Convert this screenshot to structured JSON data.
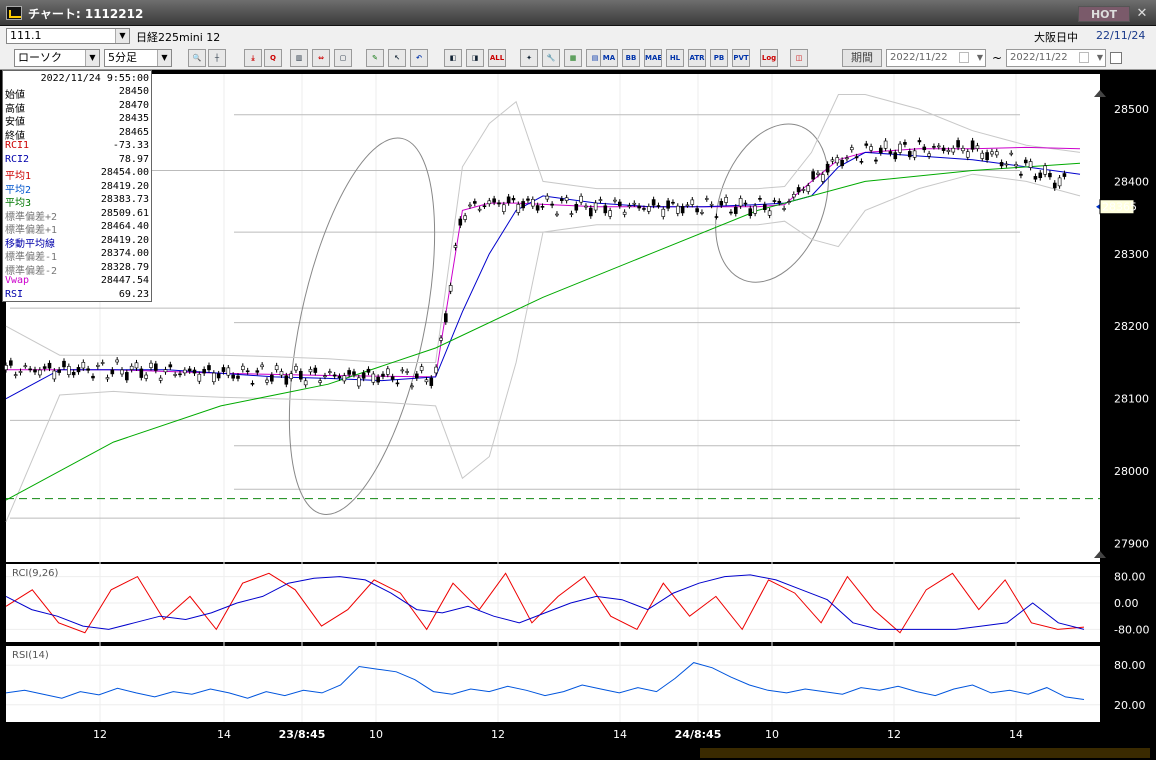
{
  "window": {
    "title": "チャート: 1112212",
    "hot_label": "HOT",
    "close_glyph": "✕"
  },
  "row1": {
    "code": "111.1",
    "instrument": "日経225mini 12",
    "market": "大阪日中",
    "date": "22/11/24"
  },
  "toolbar": {
    "chart_type": "ローソク",
    "interval": "5分足",
    "period_label": "期間",
    "date_from": "2022/11/22",
    "date_to": "2022/11/22",
    "tilde": "~",
    "buttons": [
      {
        "name": "zoom-icon",
        "glyph": "🔍",
        "cls": "ic-blue"
      },
      {
        "name": "crosshair-icon",
        "glyph": "┼",
        "cls": ""
      },
      {
        "name": "cursor-icon",
        "glyph": "⤓",
        "cls": "ic-red"
      },
      {
        "name": "magnifier-icon",
        "glyph": "Q",
        "cls": "ic-red"
      },
      {
        "name": "bar-chart-icon",
        "glyph": "▥",
        "cls": ""
      },
      {
        "name": "order-icon",
        "glyph": "⇔",
        "cls": "ic-red"
      },
      {
        "name": "disabled-icon",
        "glyph": "▢",
        "cls": ""
      },
      {
        "name": "pencil-icon",
        "glyph": "✎",
        "cls": "ic-green"
      },
      {
        "name": "select-arrow-icon",
        "glyph": "↖",
        "cls": ""
      },
      {
        "name": "undo-icon",
        "glyph": "↶",
        "cls": "ic-blue"
      },
      {
        "name": "candle-left-icon",
        "glyph": "◧",
        "cls": ""
      },
      {
        "name": "candle-right-icon",
        "glyph": "◨",
        "cls": ""
      },
      {
        "name": "all-icon",
        "glyph": "ALL",
        "cls": "ic-red"
      },
      {
        "name": "tools-icon",
        "glyph": "✦",
        "cls": ""
      },
      {
        "name": "wrench-icon",
        "glyph": "🔧",
        "cls": "ic-red"
      },
      {
        "name": "palette-icon",
        "glyph": "▦",
        "cls": "ic-green"
      },
      {
        "name": "grid-icon",
        "glyph": "▤",
        "cls": "ic-blue"
      },
      {
        "name": "ma-icon",
        "glyph": "MA",
        "cls": "ic-blue"
      },
      {
        "name": "bb-icon",
        "glyph": "BB",
        "cls": "ic-blue"
      },
      {
        "name": "mae-icon",
        "glyph": "MAE",
        "cls": "ic-blue"
      },
      {
        "name": "hl-icon",
        "glyph": "HL",
        "cls": "ic-blue"
      },
      {
        "name": "atr-icon",
        "glyph": "ATR",
        "cls": "ic-blue"
      },
      {
        "name": "pb-icon",
        "glyph": "PB",
        "cls": "ic-blue"
      },
      {
        "name": "pvt-icon",
        "glyph": "PVT",
        "cls": "ic-blue"
      },
      {
        "name": "log-icon",
        "glyph": "Log",
        "cls": "ic-red"
      },
      {
        "name": "split-icon",
        "glyph": "◫",
        "cls": "ic-red"
      }
    ]
  },
  "info": {
    "timestamp": "2022/11/24 9:55:00",
    "rows": [
      {
        "k": "始値",
        "v": "28450",
        "color": "#000000"
      },
      {
        "k": "高値",
        "v": "28470",
        "color": "#000000"
      },
      {
        "k": "安値",
        "v": "28435",
        "color": "#000000"
      },
      {
        "k": "終値",
        "v": "28465",
        "color": "#000000"
      },
      {
        "k": "RCI1",
        "v": "-73.33",
        "color": "#cc0000"
      },
      {
        "k": "RCI2",
        "v": "78.97",
        "color": "#0000aa"
      },
      {
        "k": "平均1",
        "v": "28454.00",
        "color": "#cc0000"
      },
      {
        "k": "平均2",
        "v": "28419.20",
        "color": "#0055cc"
      },
      {
        "k": "平均3",
        "v": "28383.73",
        "color": "#007700"
      },
      {
        "k": "標準偏差+2",
        "v": "28509.61",
        "color": "#777777"
      },
      {
        "k": "標準偏差+1",
        "v": "28464.40",
        "color": "#777777"
      },
      {
        "k": "移動平均線",
        "v": "28419.20",
        "color": "#0000aa"
      },
      {
        "k": "標準偏差-1",
        "v": "28374.00",
        "color": "#777777"
      },
      {
        "k": "標準偏差-2",
        "v": "28328.79",
        "color": "#777777"
      },
      {
        "k": "Vwap",
        "v": "28447.54",
        "color": "#cc00cc"
      },
      {
        "k": "RSI",
        "v": "69.23",
        "color": "#0000aa"
      }
    ]
  },
  "chart_data": {
    "type": "line",
    "price_axis": {
      "ticks": [
        "28500",
        "28400",
        "28300",
        "28200",
        "28100",
        "28000",
        "27900"
      ],
      "min": 27900,
      "max": 28500
    },
    "current_price": "28365",
    "x_ticks": [
      "12",
      "14",
      "23/8:45",
      "10",
      "12",
      "14",
      "24/8:45",
      "10",
      "12",
      "14"
    ],
    "horizontal_levels": [
      28492,
      28415,
      28330,
      28225,
      28205,
      28070,
      28035,
      27935,
      27975
    ],
    "dashed_level": 27962,
    "series": [
      {
        "name": "Bollinger +2σ",
        "color": "#c8c8c8",
        "x": [
          0,
          2,
          4,
          6,
          8,
          10,
          12,
          14,
          16,
          17,
          18,
          19,
          20,
          22,
          24,
          26,
          28,
          29,
          30,
          31,
          32,
          34,
          36,
          38,
          40
        ],
        "y": [
          28200,
          28160,
          28160,
          28160,
          28160,
          28158,
          28155,
          28150,
          28150,
          28420,
          28480,
          28510,
          28400,
          28390,
          28390,
          28390,
          28390,
          28393,
          28440,
          28520,
          28520,
          28500,
          28470,
          28450,
          28440
        ]
      },
      {
        "name": "Bollinger -2σ",
        "color": "#c8c8c8",
        "x": [
          0,
          2,
          4,
          6,
          8,
          10,
          12,
          14,
          16,
          17,
          18,
          19,
          20,
          22,
          24,
          26,
          28,
          29,
          30,
          31,
          32,
          34,
          36,
          38,
          40
        ],
        "y": [
          27930,
          28105,
          28110,
          28105,
          28102,
          28100,
          28098,
          28095,
          28090,
          27990,
          28020,
          28150,
          28330,
          28340,
          28340,
          28340,
          28340,
          28345,
          28320,
          28310,
          28360,
          28390,
          28410,
          28400,
          28380
        ]
      },
      {
        "name": "VWAP",
        "color": "#cc00cc",
        "x": [
          0,
          4,
          8,
          12,
          16,
          17,
          18,
          19,
          22,
          26,
          28,
          29,
          30,
          31,
          32,
          34,
          36,
          38,
          40
        ],
        "y": [
          28140,
          28140,
          28135,
          28132,
          28130,
          28360,
          28370,
          28370,
          28365,
          28365,
          28365,
          28368,
          28400,
          28430,
          28440,
          28445,
          28445,
          28447,
          28445
        ]
      },
      {
        "name": "平均2",
        "color": "#0000cc",
        "x": [
          0,
          2,
          4,
          6,
          8,
          10,
          12,
          14,
          16,
          17,
          18,
          19,
          20,
          22,
          24,
          26,
          28,
          29,
          30,
          31,
          32,
          34,
          36,
          38,
          40
        ],
        "y": [
          28100,
          28140,
          28140,
          28140,
          28135,
          28130,
          28128,
          28125,
          28130,
          28220,
          28300,
          28360,
          28380,
          28370,
          28365,
          28365,
          28368,
          28370,
          28380,
          28420,
          28440,
          28435,
          28430,
          28420,
          28410
        ]
      },
      {
        "name": "平均3",
        "color": "#00aa00",
        "x": [
          0,
          4,
          8,
          12,
          16,
          20,
          24,
          28,
          32,
          36,
          40
        ],
        "y": [
          27960,
          28040,
          28090,
          28120,
          28170,
          28240,
          28300,
          28360,
          28400,
          28415,
          28425
        ]
      }
    ],
    "rci": {
      "label": "RCI(9,26)",
      "ticks": [
        "80.00",
        "0.00",
        "-80.00"
      ],
      "rci1": [
        -10,
        40,
        -60,
        -90,
        40,
        80,
        -50,
        20,
        -80,
        60,
        90,
        40,
        -70,
        -20,
        70,
        30,
        -80,
        60,
        -20,
        90,
        -60,
        20,
        80,
        -40,
        -80,
        60,
        -40,
        20,
        -80,
        70,
        30,
        -60,
        80,
        -20,
        -90,
        40,
        90,
        -20,
        70,
        -60,
        -80,
        -73
      ],
      "rci2": [
        20,
        -20,
        -40,
        -70,
        -80,
        -60,
        -40,
        -50,
        -30,
        0,
        20,
        60,
        75,
        80,
        70,
        30,
        -20,
        -30,
        -10,
        -40,
        -60,
        -30,
        0,
        20,
        10,
        -20,
        30,
        60,
        80,
        85,
        70,
        40,
        10,
        -60,
        -80,
        -80,
        -80,
        -80,
        -70,
        -60,
        0,
        -60,
        -80
      ]
    },
    "rsi": {
      "label": "RSI(14)",
      "ticks": [
        "80.00",
        "20.00"
      ],
      "values": [
        38,
        42,
        36,
        30,
        40,
        35,
        45,
        38,
        32,
        40,
        36,
        44,
        38,
        30,
        40,
        34,
        42,
        38,
        50,
        78,
        74,
        70,
        58,
        40,
        36,
        44,
        40,
        48,
        42,
        34,
        40,
        50,
        44,
        38,
        46,
        40,
        60,
        84,
        76,
        62,
        50,
        42,
        38,
        44,
        40,
        36,
        46,
        42,
        48,
        40,
        34,
        44,
        50,
        38,
        42,
        36,
        46,
        32,
        28
      ]
    }
  }
}
